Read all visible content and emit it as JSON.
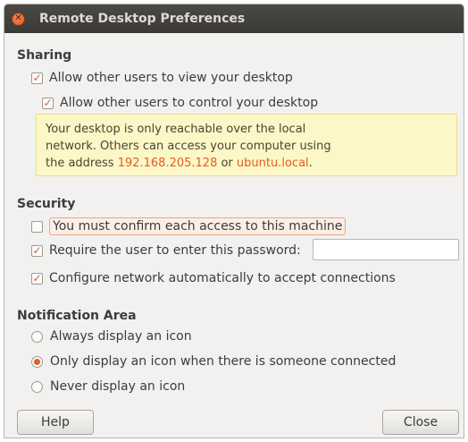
{
  "window": {
    "title": "Remote Desktop Preferences"
  },
  "sharing": {
    "title": "Sharing",
    "allow_view": {
      "label": "Allow other users to view your desktop",
      "checked": true
    },
    "allow_control": {
      "label": "Allow other users to control your desktop",
      "checked": true
    },
    "info": {
      "line1": "Your desktop is only reachable over the local",
      "line2": "network. Others can access your computer using",
      "line3_prefix": "the address ",
      "address": "192.168.205.128",
      "or": " or ",
      "hostname": "ubuntu.local",
      "end": "."
    }
  },
  "security": {
    "title": "Security",
    "confirm": {
      "label": "You must confirm each access to this machine",
      "checked": false
    },
    "require_password": {
      "label": "Require the user to enter this password:",
      "checked": true
    },
    "password_value": "",
    "configure_network": {
      "label": "Configure network automatically to accept connections",
      "checked": true
    }
  },
  "notification": {
    "title": "Notification Area",
    "options": [
      {
        "label": "Always display an icon",
        "selected": false
      },
      {
        "label": "Only display an icon when there is someone connected",
        "selected": true
      },
      {
        "label": "Never display an icon",
        "selected": false
      }
    ]
  },
  "buttons": {
    "help": "Help",
    "close": "Close"
  },
  "colors": {
    "accent": "#e35d24",
    "info_bg": "#fcf7c6"
  }
}
